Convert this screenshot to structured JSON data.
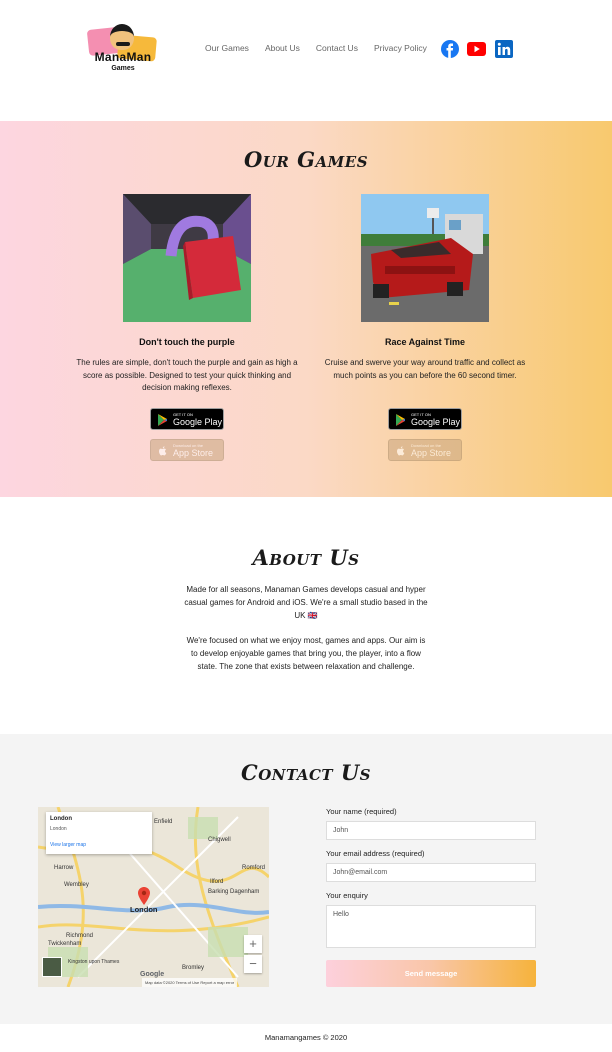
{
  "header": {
    "logo_text": "ManaMan",
    "logo_sub": "Games",
    "nav": [
      "Our Games",
      "About Us",
      "Contact Us",
      "Privacy Policy"
    ],
    "social_icons": [
      "facebook-icon",
      "youtube-icon",
      "linkedin-icon"
    ],
    "colors": {
      "facebook": "#1877f2",
      "youtube": "#ff0000",
      "linkedin": "#0a66c2"
    }
  },
  "games": {
    "title": "Our Games",
    "items": [
      {
        "name": "Don't touch the purple",
        "description": "The rules are simple, don't touch the purple and gain as high a score as possible. Designed to test your quick thinking and decision making reflexes.",
        "google_play_small": "GET IT ON",
        "google_play_big": "Google Play",
        "app_store_small": "Download on the",
        "app_store_big": "App Store"
      },
      {
        "name": "Race Against Time",
        "description": "Cruise and swerve your way around traffic and collect as much points as you can before the 60 second timer.",
        "google_play_small": "GET IT ON",
        "google_play_big": "Google Play",
        "app_store_small": "Download on the",
        "app_store_big": "App Store"
      }
    ]
  },
  "about": {
    "title": "About Us",
    "p1": "Made for all seasons, Manaman Games develops casual and hyper casual games for Android and iOS. We're a small studio based in the UK 🇬🇧",
    "p2": "We're focused on what we enjoy most, games and apps. Our aim is to develop enjoyable games that bring you, the player, into a flow state. The zone that exists between relaxation and challenge."
  },
  "contact": {
    "title": "Contact Us",
    "map": {
      "info_title": "London",
      "info_sub": "London",
      "info_link": "View larger map",
      "city": "London",
      "labels": [
        "Enfield",
        "Chigwell",
        "Romford",
        "Harrow",
        "Wembley",
        "Ilford",
        "Barking",
        "Dagenham",
        "Twickenham",
        "Richmond",
        "Kingston upon Thames",
        "Bromley"
      ],
      "footer": "Map data ©2020   Terms of Use   Report a map error",
      "google": "Google",
      "zoom_in": "+",
      "zoom_out": "−"
    },
    "form": {
      "name_label": "Your name (required)",
      "name_value": "John",
      "email_label": "Your email address (required)",
      "email_value": "John@email.com",
      "enquiry_label": "Your enquiry",
      "enquiry_value": "Hello",
      "send_label": "Send message"
    }
  },
  "footer": {
    "text": "Manamangames © 2020"
  }
}
